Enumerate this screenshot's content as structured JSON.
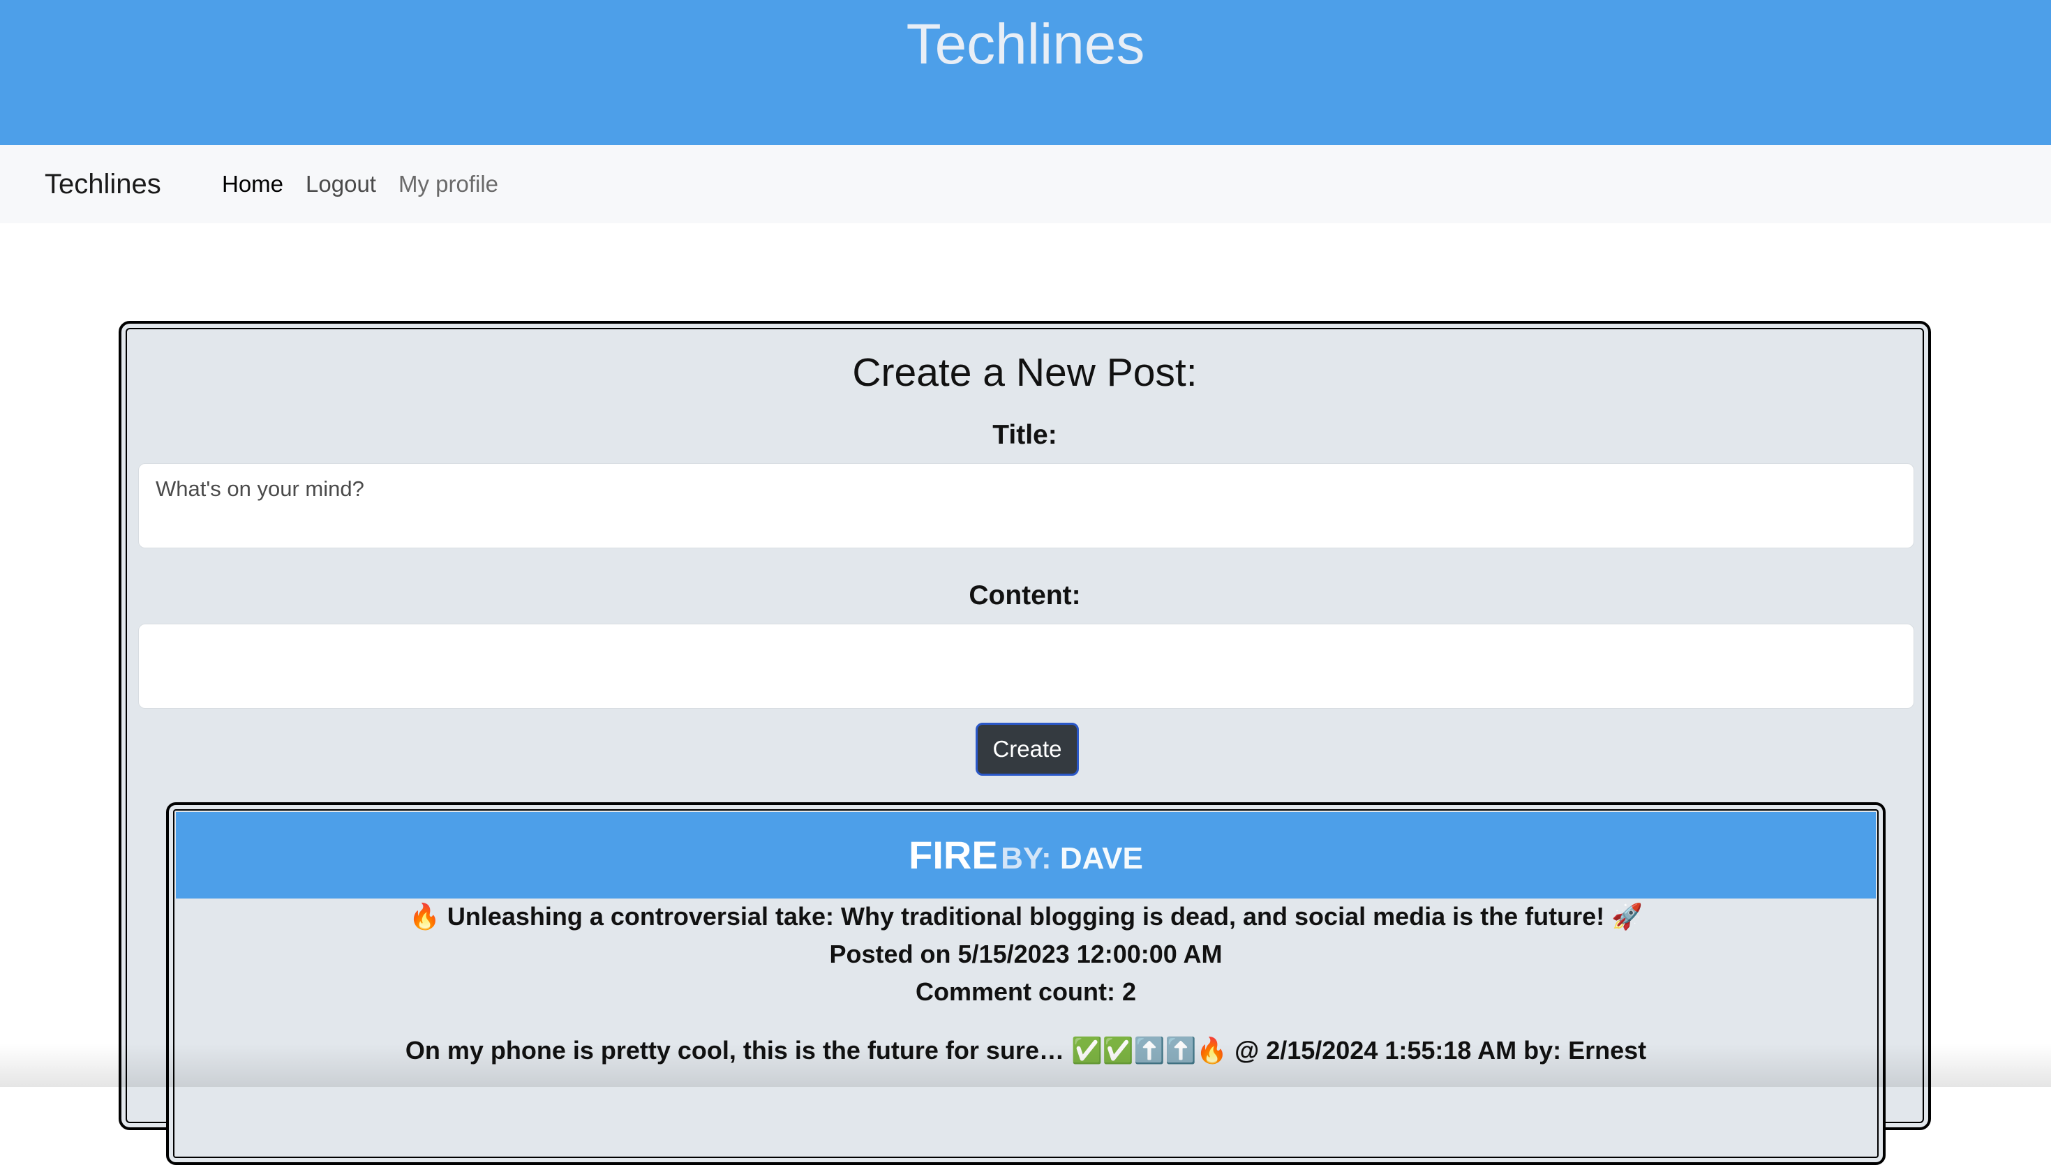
{
  "banner": {
    "title": "Techlines"
  },
  "navbar": {
    "brand": "Techlines",
    "links": {
      "home": "Home",
      "logout": "Logout",
      "profile": "My profile"
    }
  },
  "create_post": {
    "heading": "Create a New Post:",
    "title_label": "Title:",
    "title_placeholder": "What's on your mind?",
    "title_value": "",
    "content_label": "Content:",
    "content_placeholder": "",
    "content_value": "",
    "button_label": "Create"
  },
  "post": {
    "title": "FIRE",
    "by_prefix": "BY:",
    "author": "DAVE",
    "body": "🔥 Unleashing a controversial take: Why traditional blogging is dead, and social media is the future! 🚀",
    "posted_on": "Posted on 5/15/2023 12:00:00 AM",
    "comment_count": "Comment count: 2",
    "comments": [
      "On my phone is pretty cool, this is the future for sure… ✅✅⬆️⬆️🔥 @ 2/15/2024 1:55:18 AM by: Ernest"
    ]
  },
  "colors": {
    "banner_blue": "#4d9fe9",
    "navbar_bg": "#f7f8fa",
    "card_bg": "#e2e7ec",
    "button_bg": "#343a40",
    "button_border": "#2b58c8"
  }
}
